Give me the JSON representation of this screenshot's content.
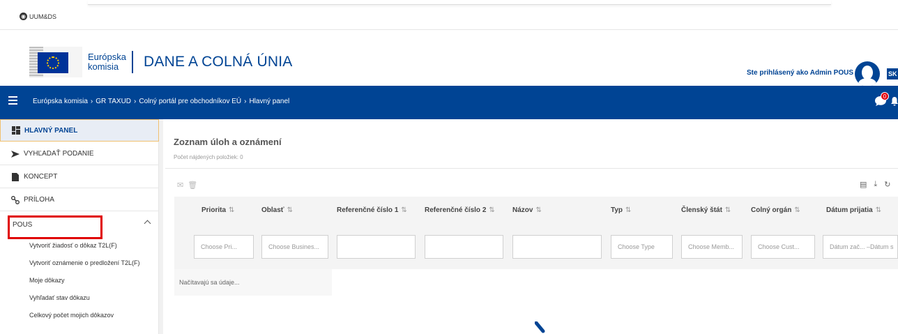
{
  "topbar": {
    "environment": "UUM&DS"
  },
  "header": {
    "logo_line1": "Európska",
    "logo_line2": "komisia",
    "site_title": "DANE A COLNÁ ÚNIA",
    "user_text": "Ste prihlásený ako Admin POUS",
    "language": "SK"
  },
  "navbar": {
    "breadcrumb": [
      "Európska komisia",
      "GR TAXUD",
      "Colný portál pre obchodníkov EÚ",
      "Hlavný panel"
    ],
    "notification_count": "0"
  },
  "sidebar": {
    "items": [
      {
        "label": "HLAVNÝ PANEL",
        "icon": "dashboard-icon"
      },
      {
        "label": "VYHĽADAŤ PODANIE",
        "icon": "arrow-right-icon"
      },
      {
        "label": "KONCEPT",
        "icon": "file-icon"
      },
      {
        "label": "PRÍLOHA",
        "icon": "paperclip-icon"
      }
    ],
    "section": "POUS",
    "sub_items": [
      "Vytvoriť žiadosť o dôkaz T2L(F)",
      "Vytvoriť oznámenie o predložení T2L(F)",
      "Moje dôkazy",
      "Vyhľadať stav dôkazu",
      "Celkový počet mojich dôkazov"
    ]
  },
  "main": {
    "title": "Zoznam úloh a oznámení",
    "count_text": "Počet nájdených položiek: 0",
    "loading_text": "Načítavajú sa údaje...",
    "columns": [
      {
        "label": "Priorita",
        "placeholder": "Choose Pri..."
      },
      {
        "label": "Oblasť",
        "placeholder": "Choose Busines..."
      },
      {
        "label": "Referenčné číslo 1",
        "placeholder": ""
      },
      {
        "label": "Referenčné číslo 2",
        "placeholder": ""
      },
      {
        "label": "Názov",
        "placeholder": ""
      },
      {
        "label": "Typ",
        "placeholder": "Choose Type"
      },
      {
        "label": "Členský štát",
        "placeholder": "Choose Memb..."
      },
      {
        "label": "Colný orgán",
        "placeholder": "Choose Cust..."
      },
      {
        "label": "Dátum prijatia",
        "placeholder": "Dátum zač... –Dátum s"
      }
    ]
  },
  "colors": {
    "brand_blue": "#004494",
    "badge_red": "#e3000f",
    "highlight_red": "#e00000"
  }
}
